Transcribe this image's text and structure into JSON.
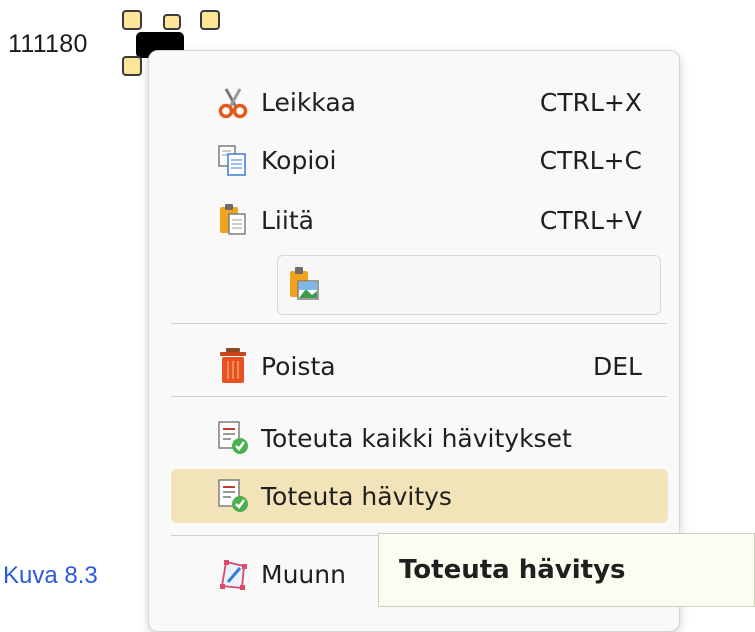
{
  "field": {
    "value": "111180"
  },
  "menu": {
    "items": [
      {
        "id": "cut",
        "label": "Leikkaa",
        "shortcut": "CTRL+X",
        "icon": "scissors-icon"
      },
      {
        "id": "copy",
        "label": "Kopioi",
        "shortcut": "CTRL+C",
        "icon": "copy-icon"
      },
      {
        "id": "paste",
        "label": "Liitä",
        "shortcut": "CTRL+V",
        "icon": "paste-icon"
      },
      {
        "id": "paste-special",
        "label": "",
        "shortcut": "",
        "icon": "paste-image-icon"
      },
      {
        "id": "delete",
        "label": "Poista",
        "shortcut": "DEL",
        "icon": "trash-icon"
      },
      {
        "id": "apply-all",
        "label": "Toteuta kaikki hävitykset",
        "shortcut": "",
        "icon": "apply-document-icon"
      },
      {
        "id": "apply",
        "label": "Toteuta hävitys",
        "shortcut": "",
        "icon": "apply-document-icon",
        "highlighted": true
      },
      {
        "id": "transform",
        "label": "Muunn",
        "shortcut": "",
        "icon": "transform-icon"
      }
    ]
  },
  "tooltip": {
    "text": "Toteuta hävitys"
  },
  "caption": {
    "text": "Kuva 8.3"
  },
  "colors": {
    "highlight": "#f3e3b8",
    "caption": "#2a5bd8",
    "handle": "#fde59a"
  }
}
